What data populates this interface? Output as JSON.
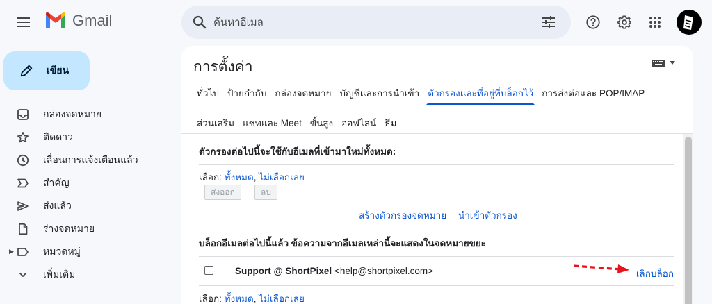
{
  "header": {
    "app_name": "Gmail",
    "search_placeholder": "ค้นหาอีเมล"
  },
  "sidebar": {
    "compose_label": "เขียน",
    "items": [
      {
        "label": "กล่องจดหมาย",
        "icon": "inbox-icon"
      },
      {
        "label": "ติดดาว",
        "icon": "star-icon"
      },
      {
        "label": "เลื่อนการแจ้งเตือนแล้ว",
        "icon": "clock-icon"
      },
      {
        "label": "สำคัญ",
        "icon": "label-important-icon"
      },
      {
        "label": "ส่งแล้ว",
        "icon": "send-icon"
      },
      {
        "label": "ร่างจดหมาย",
        "icon": "file-icon"
      },
      {
        "label": "หมวดหมู่",
        "icon": "label-icon"
      },
      {
        "label": "เพิ่มเติม",
        "icon": "chevron-down-icon"
      }
    ]
  },
  "settings": {
    "title": "การตั้งค่า",
    "tabs_row1": [
      {
        "label": "ทั่วไป",
        "active": false
      },
      {
        "label": "ป้ายกำกับ",
        "active": false
      },
      {
        "label": "กล่องจดหมาย",
        "active": false
      },
      {
        "label": "บัญชีและการนำเข้า",
        "active": false
      },
      {
        "label": "ตัวกรองและที่อยู่ที่บล็อกไว้",
        "active": true
      },
      {
        "label": "การส่งต่อและ POP/IMAP",
        "active": false
      }
    ],
    "tabs_row2": [
      {
        "label": "ส่วนเสริม",
        "active": false
      },
      {
        "label": "แชทและ Meet",
        "active": false
      },
      {
        "label": "ขั้นสูง",
        "active": false
      },
      {
        "label": "ออฟไลน์",
        "active": false
      },
      {
        "label": "ธีม",
        "active": false
      }
    ]
  },
  "filters": {
    "heading": "ตัวกรองต่อไปนี้จะใช้กับอีเมลที่เข้ามาใหม่ทั้งหมด:",
    "select_label": "เลือก: ",
    "select_all": "ทั้งหมด",
    "comma": ", ",
    "select_none": "ไม่เลือกเลย",
    "export_button": "ส่งออก",
    "delete_button": "ลบ",
    "create_filter": "สร้างตัวกรองจดหมาย",
    "import_filters": "นำเข้าตัวกรอง"
  },
  "blocked": {
    "heading": "บล็อกอีเมลต่อไปนี้แล้ว ข้อความจากอีเมลเหล่านี้จะแสดงในจดหมายขยะ",
    "entry_name": "Support @ ShortPixel",
    "entry_email": " <help@shortpixel.com>",
    "unblock": "เลิกบล็อก",
    "select_label": "เลือก: ",
    "select_all": "ทั้งหมด",
    "comma": ", ",
    "select_none": "ไม่เลือกเลย"
  },
  "colors": {
    "accent": "#0b57d0",
    "compose_bg": "#c2e7ff",
    "annotation_arrow": "#e8131b"
  }
}
